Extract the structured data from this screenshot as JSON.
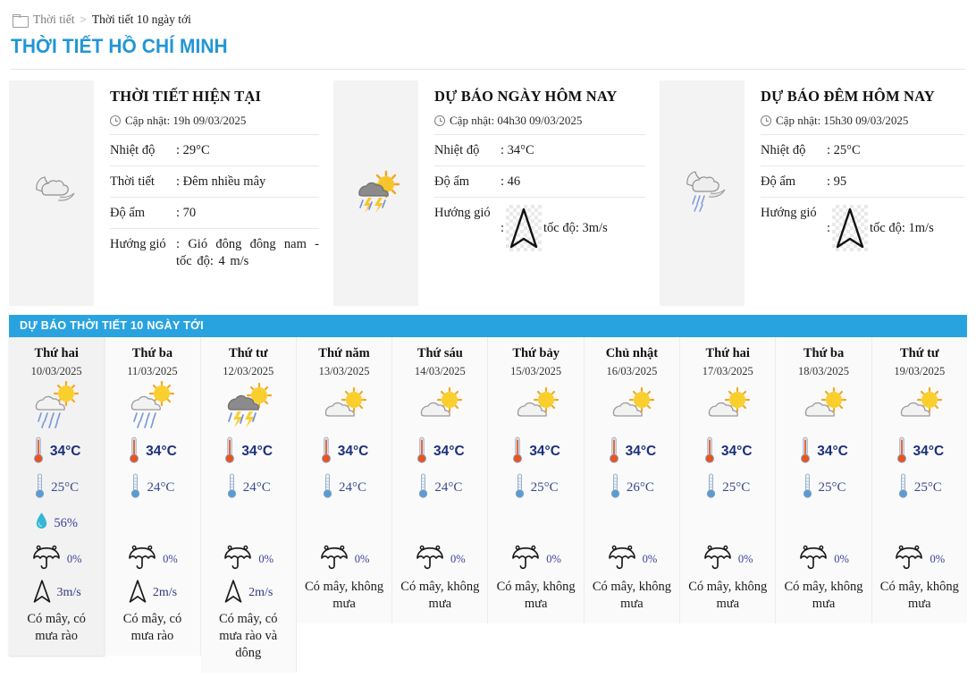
{
  "breadcrumb": {
    "folder_icon": "folder-icon",
    "parent": "Thời tiết",
    "separator": ">",
    "current": "Thời tiết 10 ngày tới"
  },
  "page_title": "THỜI TIẾT HỒ CHÍ MINH",
  "colors": {
    "accent_blue": "#29a3e0",
    "title_blue": "#2196d6",
    "value_blue": "#3a3f9c",
    "card_bg": "#f3f3f3"
  },
  "cards": [
    {
      "title": "THỜI TIẾT HIỆN TẠI",
      "updated_label": "Cập nhật:",
      "updated_value": "19h 09/03/2025",
      "updated_full": "Cập nhật: 19h 09/03/2025",
      "icon": "cloud-night-icon",
      "rows": [
        {
          "key": "Nhiệt độ",
          "sep": ":",
          "value": "29°C"
        },
        {
          "key": "Thời tiết",
          "sep": ":",
          "value": "Đêm nhiều mây"
        },
        {
          "key": "Độ ẩm",
          "sep": ":",
          "value": "70"
        },
        {
          "key": "Hướng gió",
          "sep": ":",
          "value": "Gió đông đông nam - tốc độ: 4 m/s"
        }
      ]
    },
    {
      "title": "DỰ BÁO NGÀY HÔM NAY",
      "updated_label": "Cập nhật:",
      "updated_value": "04h30 09/03/2025",
      "updated_full": "Cập nhật: 04h30 09/03/2025",
      "icon": "thunderstorm-sun-icon",
      "rows": [
        {
          "key": "Nhiệt độ",
          "sep": ":",
          "value": "34°C"
        },
        {
          "key": "Độ ẩm",
          "sep": ":",
          "value": "46"
        }
      ],
      "wind_row": {
        "key": "Hướng gió",
        "sep": ":",
        "arrow_icon": "arrow-north-icon",
        "speed": "tốc độ: 3m/s"
      }
    },
    {
      "title": "DỰ BÁO ĐÊM HÔM NAY",
      "updated_label": "Cập nhật:",
      "updated_value": "15h30 09/03/2025",
      "updated_full": "Cập nhật: 15h30 09/03/2025",
      "icon": "cloud-night-rain-icon",
      "rows": [
        {
          "key": "Nhiệt độ",
          "sep": ":",
          "value": "25°C"
        },
        {
          "key": "Độ ẩm",
          "sep": ":",
          "value": "95"
        }
      ],
      "wind_row": {
        "key": "Hướng gió",
        "sep": ":",
        "arrow_icon": "arrow-north-icon",
        "speed": "tốc độ: 1m/s"
      }
    }
  ],
  "forecast": {
    "header": "DỰ BÁO THỜI TIẾT 10 NGÀY TỚI",
    "days": [
      {
        "name": "Thứ hai",
        "date": "10/03/2025",
        "icon": "cloud-sun-rain-icon",
        "temp_high": "34°C",
        "temp_low": "25°C",
        "humidity": "56%",
        "rain_chance": "0%",
        "wind": "3m/s",
        "desc": "Có mây, có mưa rào",
        "selected": true
      },
      {
        "name": "Thứ ba",
        "date": "11/03/2025",
        "icon": "cloud-sun-rain-icon",
        "temp_high": "34°C",
        "temp_low": "24°C",
        "humidity": "",
        "rain_chance": "0%",
        "wind": "2m/s",
        "desc": "Có mây, có mưa rào",
        "selected": false
      },
      {
        "name": "Thứ tư",
        "date": "12/03/2025",
        "icon": "thunderstorm-sun-icon",
        "temp_high": "34°C",
        "temp_low": "24°C",
        "humidity": "",
        "rain_chance": "0%",
        "wind": "2m/s",
        "desc": "Có mây, có mưa rào và dông",
        "selected": false
      },
      {
        "name": "Thứ năm",
        "date": "13/03/2025",
        "icon": "cloud-sun-icon",
        "temp_high": "34°C",
        "temp_low": "24°C",
        "humidity": "",
        "rain_chance": "0%",
        "wind": "",
        "desc": "Có mây, không mưa",
        "selected": false
      },
      {
        "name": "Thứ sáu",
        "date": "14/03/2025",
        "icon": "cloud-sun-icon",
        "temp_high": "34°C",
        "temp_low": "24°C",
        "humidity": "",
        "rain_chance": "0%",
        "wind": "",
        "desc": "Có mây, không mưa",
        "selected": false
      },
      {
        "name": "Thứ bảy",
        "date": "15/03/2025",
        "icon": "cloud-sun-icon",
        "temp_high": "34°C",
        "temp_low": "25°C",
        "humidity": "",
        "rain_chance": "0%",
        "wind": "",
        "desc": "Có mây, không mưa",
        "selected": false
      },
      {
        "name": "Chủ nhật",
        "date": "16/03/2025",
        "icon": "cloud-sun-icon",
        "temp_high": "34°C",
        "temp_low": "26°C",
        "humidity": "",
        "rain_chance": "0%",
        "wind": "",
        "desc": "Có mây, không mưa",
        "selected": false
      },
      {
        "name": "Thứ hai",
        "date": "17/03/2025",
        "icon": "cloud-sun-icon",
        "temp_high": "34°C",
        "temp_low": "25°C",
        "humidity": "",
        "rain_chance": "0%",
        "wind": "",
        "desc": "Có mây, không mưa",
        "selected": false
      },
      {
        "name": "Thứ ba",
        "date": "18/03/2025",
        "icon": "cloud-sun-icon",
        "temp_high": "34°C",
        "temp_low": "25°C",
        "humidity": "",
        "rain_chance": "0%",
        "wind": "",
        "desc": "Có mây, không mưa",
        "selected": false
      },
      {
        "name": "Thứ tư",
        "date": "19/03/2025",
        "icon": "cloud-sun-icon",
        "temp_high": "34°C",
        "temp_low": "25°C",
        "humidity": "",
        "rain_chance": "0%",
        "wind": "",
        "desc": "Có mây, không mưa",
        "selected": false
      }
    ]
  }
}
